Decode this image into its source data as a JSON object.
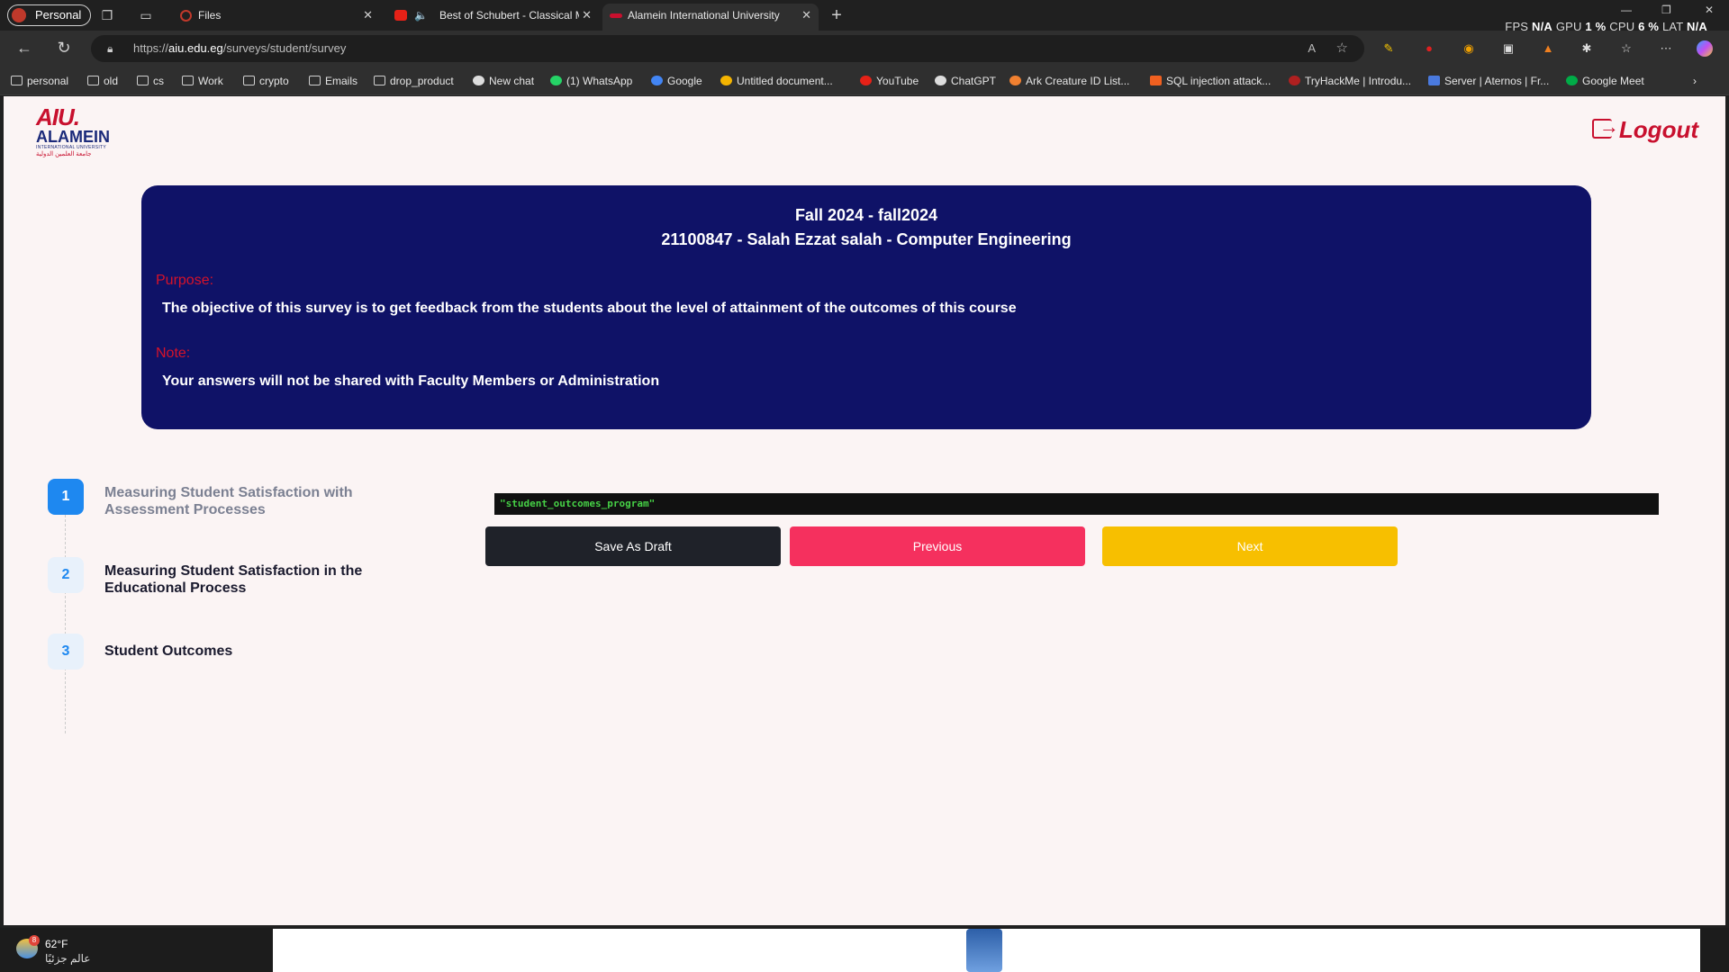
{
  "browser": {
    "profile_label": "Personal",
    "tabs": [
      {
        "label": "Files",
        "favicon": "loading-icon",
        "active": false
      },
      {
        "label": "Best of Schubert - Classical M",
        "favicon": "youtube-icon",
        "active": false
      },
      {
        "label": "Alamein International University",
        "favicon": "aiu-icon",
        "active": true
      }
    ],
    "stats": {
      "fps_label": "FPS",
      "fps_value": "N/A",
      "gpu_label": "GPU",
      "gpu_value": "1 %",
      "cpu_label": "CPU",
      "cpu_value": "6 %",
      "lat_label": "LAT",
      "lat_value": "N/A"
    },
    "url": {
      "prefix": "https://",
      "host": "aiu.edu.eg",
      "path": "/surveys/student/survey"
    },
    "bookmarks": [
      {
        "label": "personal",
        "icon": "folder-icon"
      },
      {
        "label": "old",
        "icon": "folder-icon"
      },
      {
        "label": "cs",
        "icon": "folder-icon"
      },
      {
        "label": "Work",
        "icon": "folder-icon"
      },
      {
        "label": "crypto",
        "icon": "folder-icon"
      },
      {
        "label": "Emails",
        "icon": "folder-icon"
      },
      {
        "label": "drop_product",
        "icon": "folder-icon"
      },
      {
        "label": "New chat",
        "icon": "openai-icon"
      },
      {
        "label": "(1) WhatsApp",
        "icon": "whatsapp-icon"
      },
      {
        "label": "Google",
        "icon": "google-icon"
      },
      {
        "label": "Untitled document...",
        "icon": "drive-icon"
      },
      {
        "label": "YouTube",
        "icon": "youtube-icon"
      },
      {
        "label": "ChatGPT",
        "icon": "openai-icon"
      },
      {
        "label": "Ark Creature ID List...",
        "icon": "ark-icon"
      },
      {
        "label": "SQL injection attack...",
        "icon": "portswigger-icon"
      },
      {
        "label": "TryHackMe | Introdu...",
        "icon": "tryhackme-icon"
      },
      {
        "label": "Server | Aternos | Fr...",
        "icon": "aternos-icon"
      },
      {
        "label": "Google Meet",
        "icon": "meet-icon"
      }
    ]
  },
  "page": {
    "logo": {
      "line1": "AIU.",
      "line2": "ALAMEIN",
      "line3": "INTERNATIONAL UNIVERSITY",
      "line4": "جامعة العلمين الدولية"
    },
    "logout_label": "Logout",
    "banner": {
      "term": "Fall 2024 - fall2024",
      "student": "21100847 - Salah Ezzat salah - Computer Engineering",
      "purpose_label": "Purpose:",
      "purpose_text": "The objective of this survey is to get feedback from the students about the level of attainment of the outcomes of this course",
      "note_label": "Note:",
      "note_text": "Your answers will not be shared with Faculty Members or Administration"
    },
    "steps": [
      {
        "number": "1",
        "label": "Measuring Student Satisfaction with Assessment Processes",
        "state": "active"
      },
      {
        "number": "2",
        "label": "Measuring Student Satisfaction in the Educational Process",
        "state": "pending"
      },
      {
        "number": "3",
        "label": "Student Outcomes",
        "state": "pending"
      }
    ],
    "code_text": "\"student_outcomes_program\"",
    "buttons": {
      "draft": "Save As Draft",
      "previous": "Previous",
      "next": "Next"
    }
  },
  "taskbar": {
    "temperature": "62°F",
    "weather_text": "عالم جزئيًا",
    "badge_count": "8"
  }
}
